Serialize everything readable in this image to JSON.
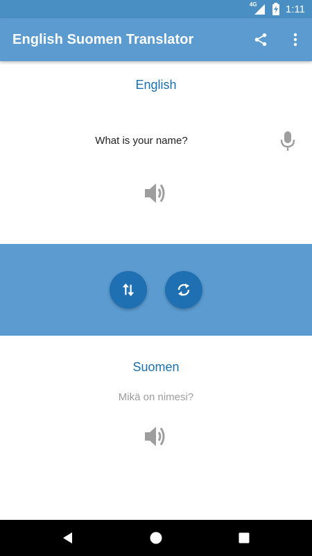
{
  "status_bar": {
    "time": "1:11",
    "network": "4G"
  },
  "app_bar": {
    "title": "English Suomen Translator",
    "icons": [
      "share-icon",
      "more-vert-icon"
    ]
  },
  "source": {
    "language": "English",
    "text": "What is your name?",
    "icons": [
      "mic-icon",
      "speaker-icon"
    ]
  },
  "controls": {
    "icons": [
      "swap-icon",
      "refresh-icon"
    ]
  },
  "target": {
    "language": "Suomen",
    "text": "Mikä on nimesi?",
    "icons": [
      "speaker-icon"
    ]
  },
  "nav_bar": {
    "icons": [
      "back-icon",
      "home-icon",
      "recents-icon"
    ]
  },
  "colors": {
    "status_bar": "#4a8fc3",
    "app_bar": "#5b9bd0",
    "control_band": "#5b9bd0",
    "round_button": "#1f6fb3",
    "language_label": "#1a6fae",
    "translated_text": "#9b9b9b",
    "icon_gray": "#9e9e9e"
  }
}
